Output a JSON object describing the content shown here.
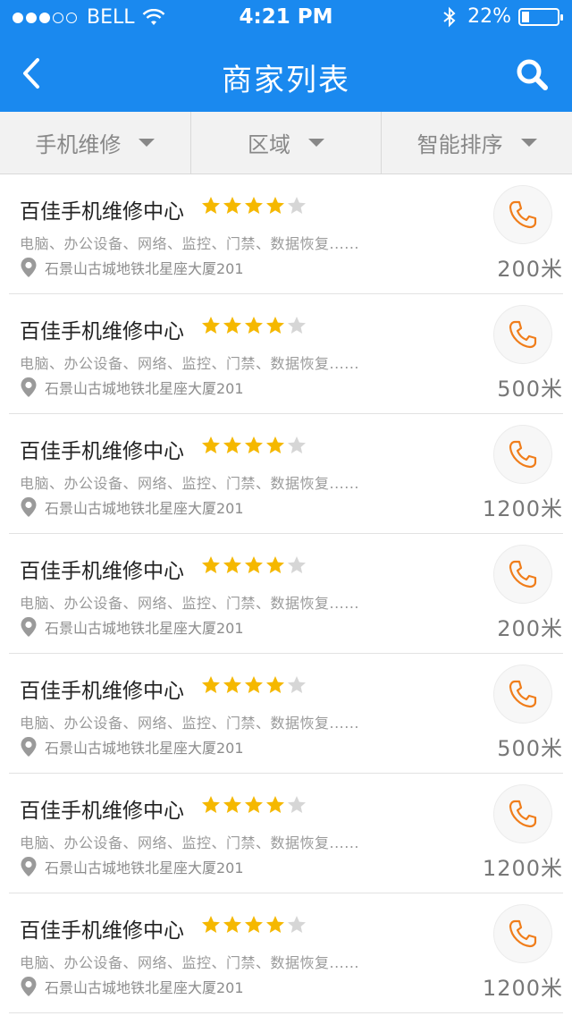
{
  "status_bar": {
    "carrier": "BELL",
    "time": "4:21 PM",
    "battery_percent": "22%",
    "battery_level": 0.22,
    "signal_bars": 3
  },
  "nav": {
    "title": "商家列表",
    "back_icon": "chevron-left-icon",
    "search_icon": "search-icon"
  },
  "filters": [
    {
      "label": "手机维修"
    },
    {
      "label": "区域"
    },
    {
      "label": "智能排序"
    }
  ],
  "colors": {
    "accent": "#1a89ef",
    "star_on": "#f5b800",
    "star_off": "#d6d6d6",
    "phone": "#f07d1a"
  },
  "merchants": [
    {
      "name": "百佳手机维修中心",
      "rating": 4,
      "services": "电脑、办公设备、网络、监控、门禁、数据恢复......",
      "address": "石景山古城地铁北星座大厦201",
      "distance": "200米"
    },
    {
      "name": "百佳手机维修中心",
      "rating": 4,
      "services": "电脑、办公设备、网络、监控、门禁、数据恢复......",
      "address": "石景山古城地铁北星座大厦201",
      "distance": "500米"
    },
    {
      "name": "百佳手机维修中心",
      "rating": 4,
      "services": "电脑、办公设备、网络、监控、门禁、数据恢复......",
      "address": "石景山古城地铁北星座大厦201",
      "distance": "1200米"
    },
    {
      "name": "百佳手机维修中心",
      "rating": 4,
      "services": "电脑、办公设备、网络、监控、门禁、数据恢复......",
      "address": "石景山古城地铁北星座大厦201",
      "distance": "200米"
    },
    {
      "name": "百佳手机维修中心",
      "rating": 4,
      "services": "电脑、办公设备、网络、监控、门禁、数据恢复......",
      "address": "石景山古城地铁北星座大厦201",
      "distance": "500米"
    },
    {
      "name": "百佳手机维修中心",
      "rating": 4,
      "services": "电脑、办公设备、网络、监控、门禁、数据恢复......",
      "address": "石景山古城地铁北星座大厦201",
      "distance": "1200米"
    },
    {
      "name": "百佳手机维修中心",
      "rating": 4,
      "services": "电脑、办公设备、网络、监控、门禁、数据恢复......",
      "address": "石景山古城地铁北星座大厦201",
      "distance": "1200米"
    }
  ]
}
